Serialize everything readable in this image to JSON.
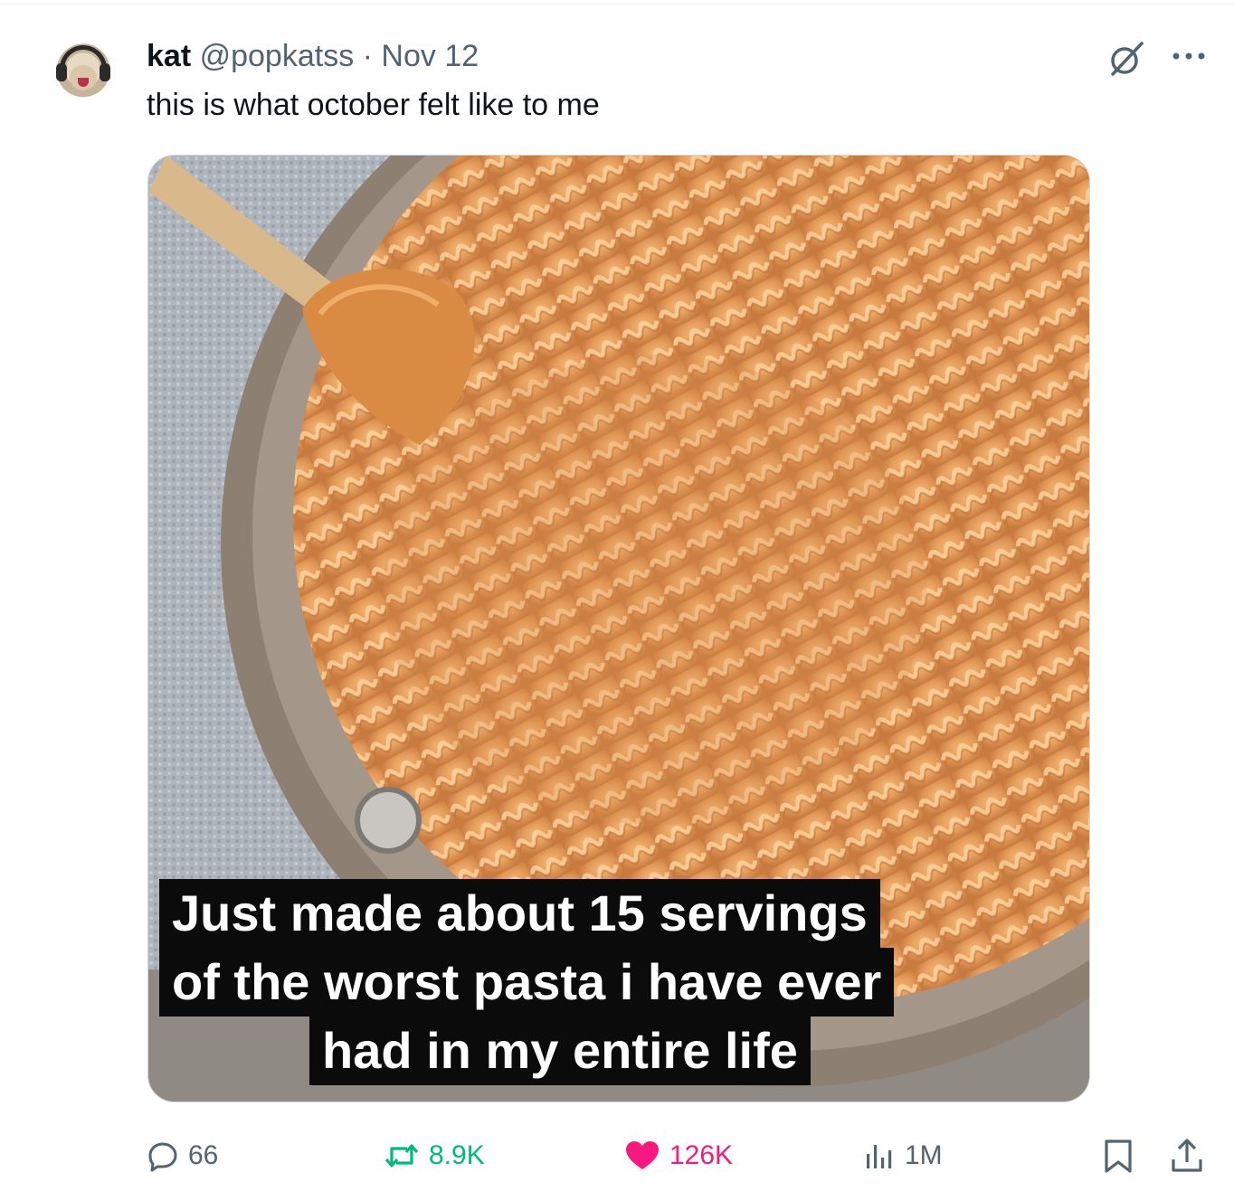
{
  "tweet": {
    "display_name": "kat",
    "handle": "@popkatss",
    "separator": " · ",
    "date": "Nov 12",
    "text": "this is what october felt like to me",
    "media": {
      "caption_lines": [
        "Just made about 15 servings",
        "of the worst pasta i have ever",
        "had in my entire life"
      ]
    },
    "stats": {
      "replies": "66",
      "reposts": "8.9K",
      "likes": "126K",
      "views": "1M"
    }
  },
  "icons": {
    "reply": "reply-bubble-icon",
    "repost": "repost-icon",
    "like": "heart-icon",
    "views": "views-bar-icon",
    "bookmark": "bookmark-icon",
    "share": "share-icon",
    "grok": "grok-icon",
    "more": "more-dots-icon"
  },
  "colors": {
    "secondary_text": "#536471",
    "repost_active": "#00ba7c",
    "like_active": "#f91880"
  }
}
